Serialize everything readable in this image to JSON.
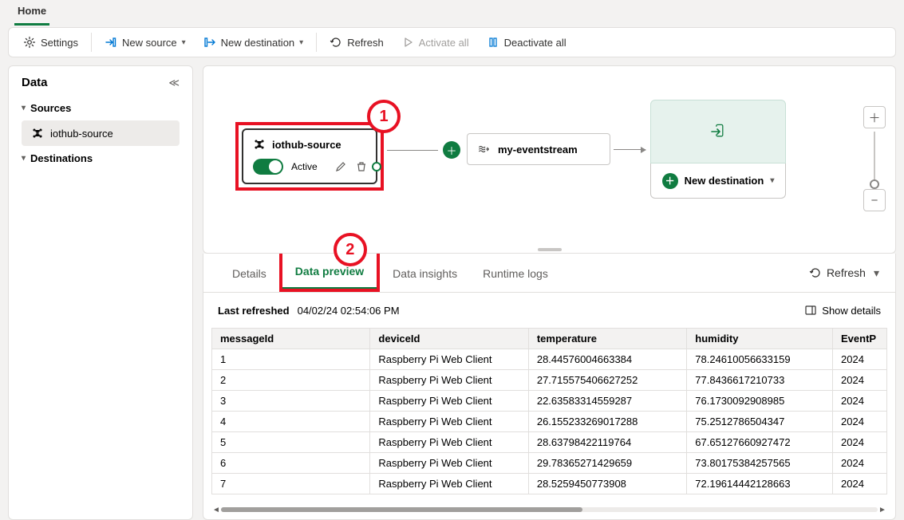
{
  "ribbon": {
    "home": "Home"
  },
  "toolbar": {
    "settings": "Settings",
    "new_source": "New source",
    "new_destination": "New destination",
    "refresh": "Refresh",
    "activate_all": "Activate all",
    "deactivate_all": "Deactivate all"
  },
  "sidebar": {
    "title": "Data",
    "group_sources": "Sources",
    "group_destinations": "Destinations",
    "source_item": "iothub-source"
  },
  "callouts": {
    "c1": "1",
    "c2": "2"
  },
  "nodes": {
    "source": {
      "title": "iothub-source",
      "status": "Active"
    },
    "stream": {
      "title": "my-eventstream"
    },
    "new_dest": "New destination"
  },
  "bottom_tabs": {
    "details": "Details",
    "preview": "Data preview",
    "insights": "Data insights",
    "runtime": "Runtime logs",
    "refresh": "Refresh"
  },
  "last_refreshed": {
    "label": "Last refreshed",
    "value": "04/02/24 02:54:06 PM",
    "show_details": "Show details"
  },
  "table": {
    "headers": {
      "messageId": "messageId",
      "deviceId": "deviceId",
      "temperature": "temperature",
      "humidity": "humidity",
      "eventp": "EventP"
    },
    "rows": [
      {
        "messageId": "1",
        "deviceId": "Raspberry Pi Web Client",
        "temperature": "28.44576004663384",
        "humidity": "78.24610056633159",
        "eventp": "2024"
      },
      {
        "messageId": "2",
        "deviceId": "Raspberry Pi Web Client",
        "temperature": "27.715575406627252",
        "humidity": "77.8436617210733",
        "eventp": "2024"
      },
      {
        "messageId": "3",
        "deviceId": "Raspberry Pi Web Client",
        "temperature": "22.63583314559287",
        "humidity": "76.1730092908985",
        "eventp": "2024"
      },
      {
        "messageId": "4",
        "deviceId": "Raspberry Pi Web Client",
        "temperature": "26.155233269017288",
        "humidity": "75.2512786504347",
        "eventp": "2024"
      },
      {
        "messageId": "5",
        "deviceId": "Raspberry Pi Web Client",
        "temperature": "28.63798422119764",
        "humidity": "67.65127660927472",
        "eventp": "2024"
      },
      {
        "messageId": "6",
        "deviceId": "Raspberry Pi Web Client",
        "temperature": "29.78365271429659",
        "humidity": "73.80175384257565",
        "eventp": "2024"
      },
      {
        "messageId": "7",
        "deviceId": "Raspberry Pi Web Client",
        "temperature": "28.5259450773908",
        "humidity": "72.19614442128663",
        "eventp": "2024"
      }
    ]
  }
}
